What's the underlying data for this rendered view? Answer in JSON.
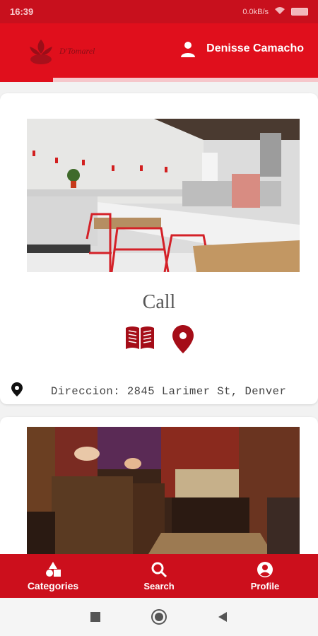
{
  "status_bar": {
    "time": "16:39",
    "network": "0.0kB/s"
  },
  "header": {
    "logo_text": "D'Tomarel",
    "user_name": "Denisse  Camacho",
    "icon": "person-icon",
    "brand_color": "#e00f1c"
  },
  "cards": [
    {
      "title": "Call",
      "actions": [
        "menu-book-icon",
        "location-pin-icon"
      ],
      "address": "Direccion: 2845 Larimer St, Denver"
    },
    {
      "title": ""
    }
  ],
  "bottom_nav": {
    "items": [
      {
        "label": "Categories",
        "icon": "categories-icon",
        "active": true
      },
      {
        "label": "Search",
        "icon": "search-icon",
        "active": false
      },
      {
        "label": "Profile",
        "icon": "profile-icon",
        "active": false
      }
    ]
  },
  "system_nav": {
    "icons": [
      "recent-apps-icon",
      "home-icon",
      "back-icon"
    ]
  }
}
